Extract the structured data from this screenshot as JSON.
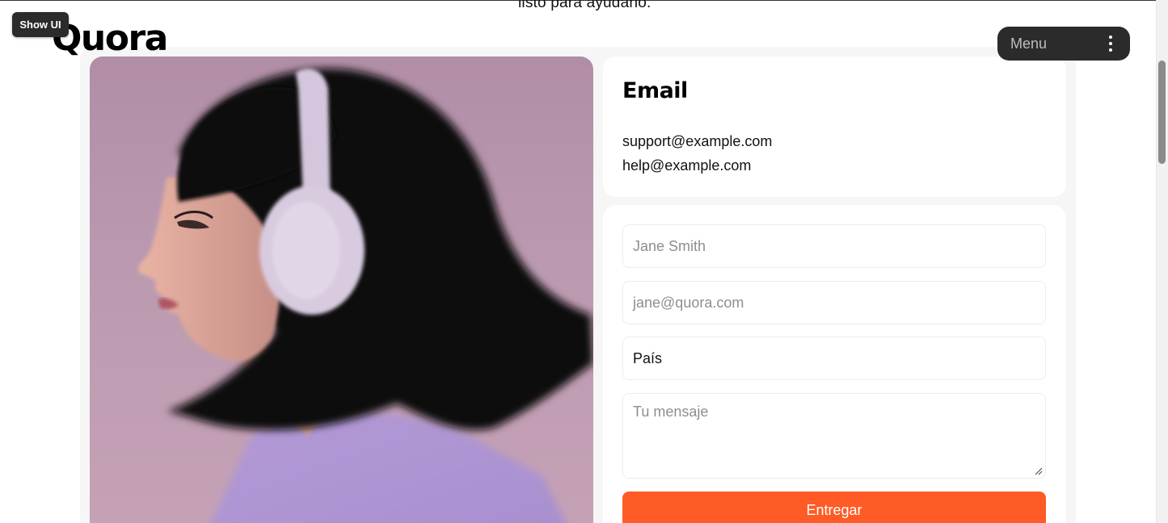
{
  "top_fragment": "listo para ayudarlo.",
  "show_ui_label": "Show UI",
  "header": {
    "logo_text": "Quora",
    "menu_label": "Menu",
    "menu_icon": "kebab-vertical-icon"
  },
  "email_card": {
    "title": "Email",
    "addresses": [
      "support@example.com",
      "help@example.com"
    ]
  },
  "form": {
    "name_placeholder": "Jane Smith",
    "email_placeholder": "jane@quora.com",
    "country_value": "País",
    "message_placeholder": "Tu mensaje",
    "submit_label": "Entregar"
  },
  "colors": {
    "accent": "#ff5b26",
    "dark_pill": "#2b2b2b",
    "photo_background": "#b794ab"
  }
}
